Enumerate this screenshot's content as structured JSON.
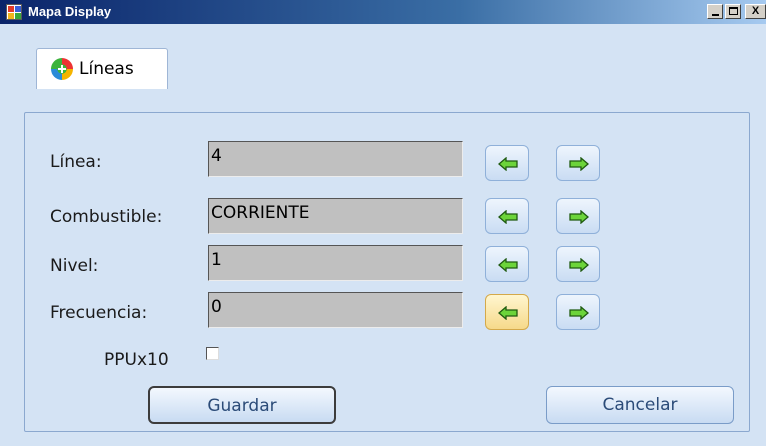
{
  "window": {
    "title": "Mapa Display"
  },
  "titlebar_buttons": {
    "minimize": "_",
    "maximize": "□",
    "close": "X"
  },
  "tab": {
    "label": "Líneas",
    "icon": "add-circle-icon"
  },
  "form": {
    "fields": [
      {
        "label": "Línea:",
        "value": "4"
      },
      {
        "label": "Combustible:",
        "value": "CORRIENTE"
      },
      {
        "label": "Nivel:",
        "value": "1"
      },
      {
        "label": "Frecuencia:",
        "value": "0"
      }
    ],
    "checkbox": {
      "label": "PPUx10",
      "checked": false
    }
  },
  "buttons": {
    "save": "Guardar",
    "cancel": "Cancelar"
  },
  "colors": {
    "arrow_fill": "#6cd43a",
    "arrow_stroke": "#1f5a10",
    "accent_hover": "#f6d98a"
  }
}
